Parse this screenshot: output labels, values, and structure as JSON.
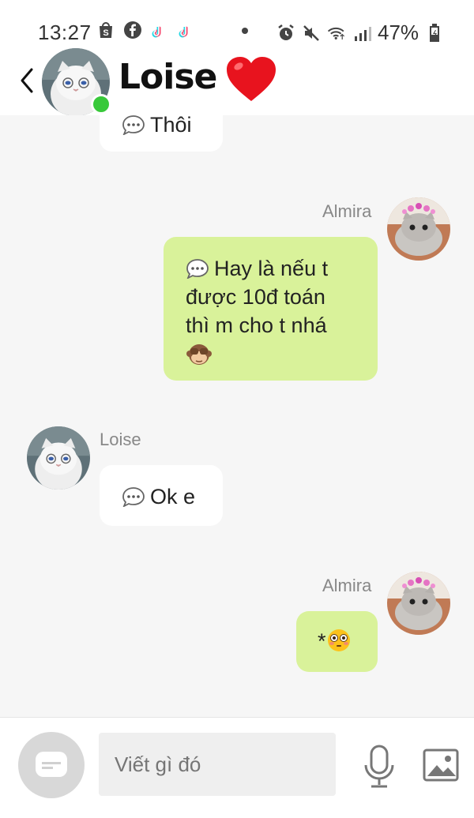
{
  "status_bar": {
    "time": "13:27",
    "battery": "47%"
  },
  "header": {
    "contact_name": "Loise",
    "back_icon": "chevron-left-icon",
    "online_color": "#38c93a"
  },
  "messages": [
    {
      "direction": "incoming",
      "text": "Thôi",
      "has_ellipsis_icon": true
    },
    {
      "direction": "outgoing",
      "sender": "Almira",
      "text_lines": [
        "Hay là nếu t",
        "được 10đ toán",
        "thì m cho t nhá"
      ],
      "emoji": "see-no-evil-monkey",
      "has_ellipsis_icon": true
    },
    {
      "direction": "incoming",
      "sender": "Loise",
      "text": "Ok e",
      "has_ellipsis_icon": true
    },
    {
      "direction": "outgoing",
      "sender": "Almira",
      "text": "*",
      "emoji": "flushed-face"
    }
  ],
  "composer": {
    "placeholder": "Viết gì đó"
  },
  "colors": {
    "outgoing_bubble": "#d9f29a",
    "incoming_bubble": "#ffffff",
    "chat_background": "#f6f6f6"
  }
}
